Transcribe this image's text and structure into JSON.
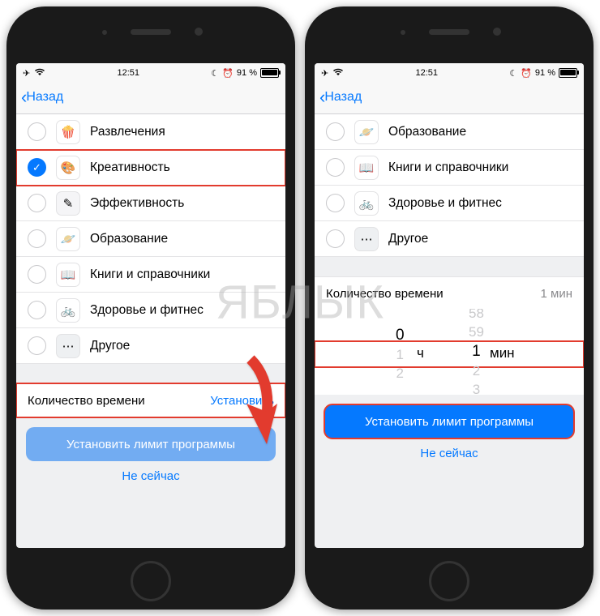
{
  "status": {
    "time": "12:51",
    "battery": "91 %"
  },
  "nav": {
    "back": "Назад"
  },
  "left": {
    "rows": [
      {
        "label": "Развлечения",
        "icon": "🍿",
        "bg": "#fff",
        "checked": false,
        "hi": false
      },
      {
        "label": "Креативность",
        "icon": "🎨",
        "bg": "#fff",
        "checked": true,
        "hi": true
      },
      {
        "label": "Эффективность",
        "icon": "✎",
        "bg": "#f5f5f7",
        "checked": false,
        "hi": false
      },
      {
        "label": "Образование",
        "icon": "🪐",
        "bg": "#fff",
        "checked": false,
        "hi": false
      },
      {
        "label": "Книги и справочники",
        "icon": "📖",
        "bg": "#fff",
        "checked": false,
        "hi": false
      },
      {
        "label": "Здоровье и фитнес",
        "icon": "🚲",
        "bg": "#fff",
        "checked": false,
        "hi": false
      },
      {
        "label": "Другое",
        "icon": "⋯",
        "bg": "#eef0f2",
        "checked": false,
        "hi": false
      }
    ],
    "section": {
      "label": "Количество времени",
      "value": "Установить"
    },
    "primary": "Установить лимит программы",
    "secondary": "Не сейчас"
  },
  "right": {
    "rows": [
      {
        "label": "Образование",
        "icon": "🪐",
        "bg": "#fff"
      },
      {
        "label": "Книги и справочники",
        "icon": "📖",
        "bg": "#fff"
      },
      {
        "label": "Здоровье и фитнес",
        "icon": "🚲",
        "bg": "#fff"
      },
      {
        "label": "Другое",
        "icon": "⋯",
        "bg": "#eef0f2"
      }
    ],
    "section": {
      "label": "Количество времени",
      "value": "1 мин"
    },
    "picker": {
      "hours": "0",
      "hunit": "ч",
      "mins": "1",
      "munit": "мин",
      "above": [
        "58",
        "59"
      ],
      "below": [
        "2",
        "3"
      ],
      "above2": [
        "",
        "59"
      ],
      "below2": [
        "2",
        "3"
      ]
    },
    "primary": "Установить лимит программы",
    "secondary": "Не сейчас"
  },
  "watermark": "ЯБЛЫК"
}
